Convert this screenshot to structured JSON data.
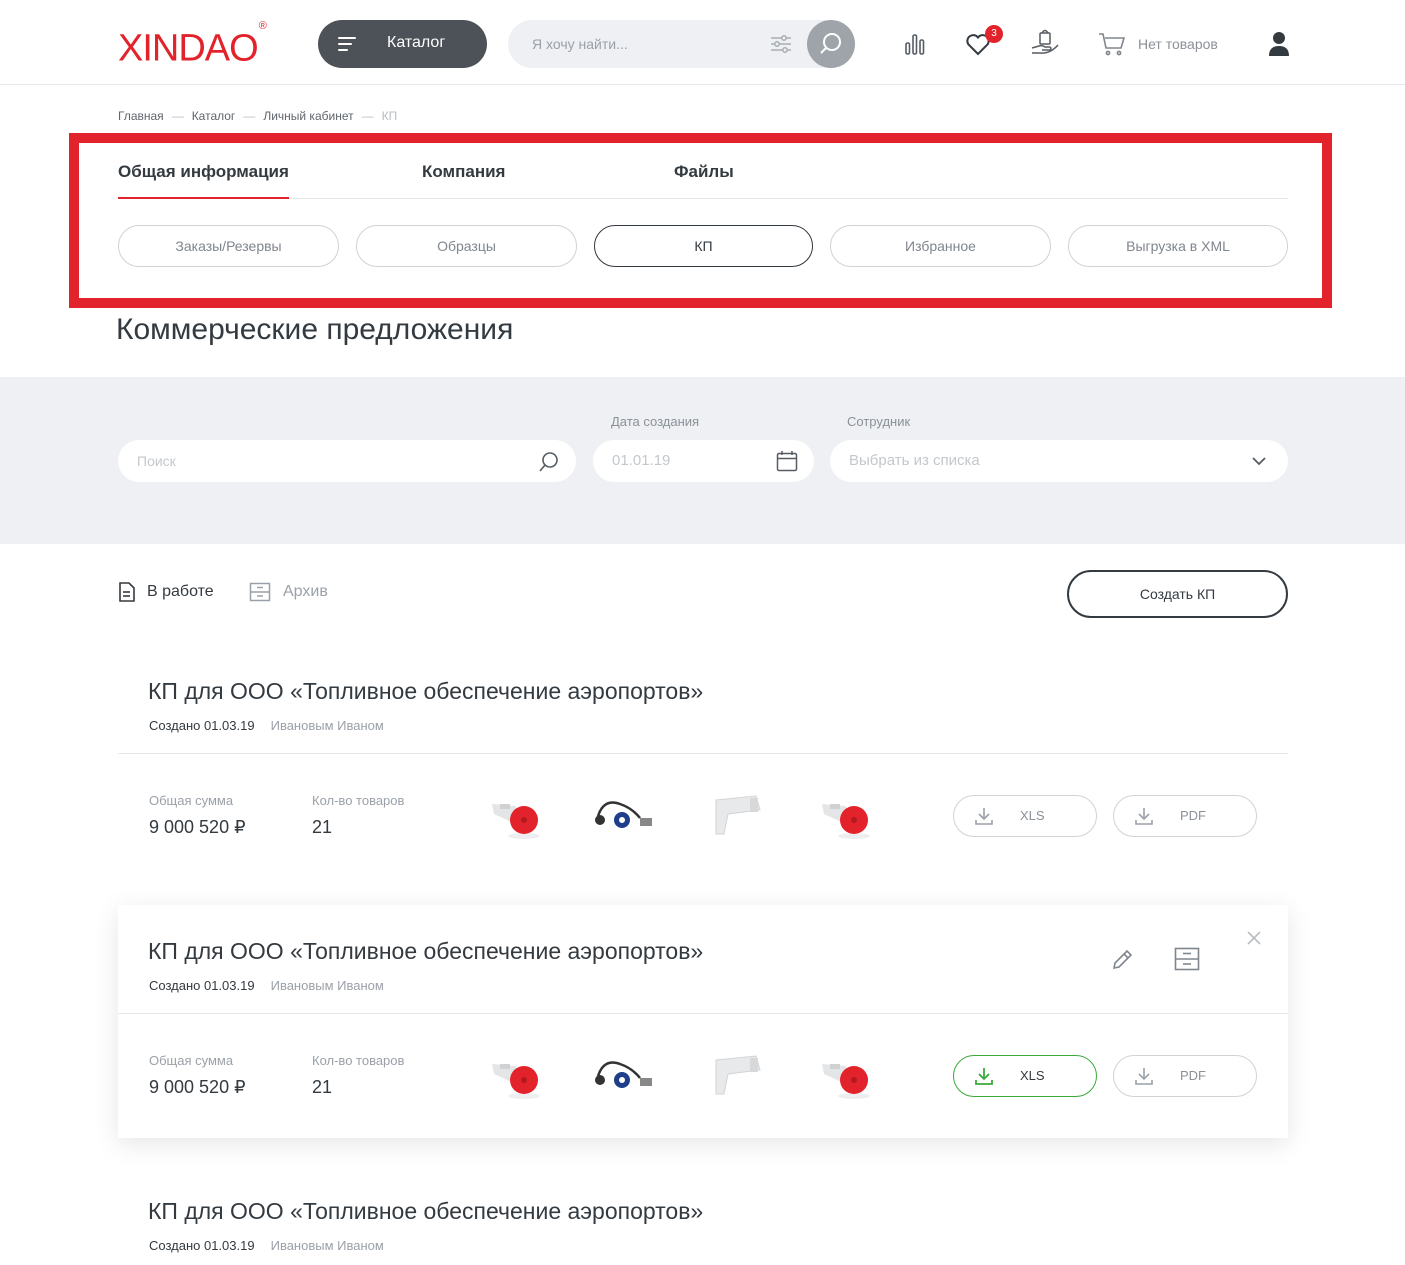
{
  "header": {
    "logo": "XINDAO",
    "logo_mark": "®",
    "catalog_label": "Каталог",
    "search_placeholder": "Я хочу найти...",
    "favorites_count": "3",
    "cart_label": "Нет товаров"
  },
  "breadcrumb": [
    "Главная",
    "Каталог",
    "Личный кабинет",
    "КП"
  ],
  "breadcrumb_sep": "—",
  "tabs": [
    "Общая информация",
    "Компания",
    "Файлы"
  ],
  "pills": [
    "Заказы/Резервы",
    "Образцы",
    "КП",
    "Избранное",
    "Выгрузка в XML"
  ],
  "page_title": "Коммерческие предложения",
  "filters": {
    "search_placeholder": "Поиск",
    "date_label": "Дата создания",
    "date_value": "01.01.19",
    "employee_label": "Сотрудник",
    "employee_placeholder": "Выбрать из списка"
  },
  "status_tabs": {
    "active": "В работе",
    "archive": "Архив"
  },
  "create_button": "Создать КП",
  "offers": [
    {
      "title": "КП для ООО «Топливное обеспечение аэропортов»",
      "created": "Создано 01.03.19",
      "author": "Ивановым Иваном",
      "sum_label": "Общая сумма",
      "sum": "9 000 520 ₽",
      "qty_label": "Кол-во товаров",
      "qty": "21",
      "xls": "XLS",
      "pdf": "PDF"
    },
    {
      "title": "КП для ООО «Топливное обеспечение аэропортов»",
      "created": "Создано 01.03.19",
      "author": "Ивановым Иваном",
      "sum_label": "Общая сумма",
      "sum": "9 000 520 ₽",
      "qty_label": "Кол-во товаров",
      "qty": "21",
      "xls": "XLS",
      "pdf": "PDF"
    },
    {
      "title": "КП для ООО «Топливное обеспечение аэропортов»",
      "created": "Создано 01.03.19",
      "author": "Ивановым Иваном"
    }
  ],
  "colors": {
    "brand_red": "#e3232b",
    "dark": "#333a40",
    "success_green": "#3aaa3a"
  }
}
